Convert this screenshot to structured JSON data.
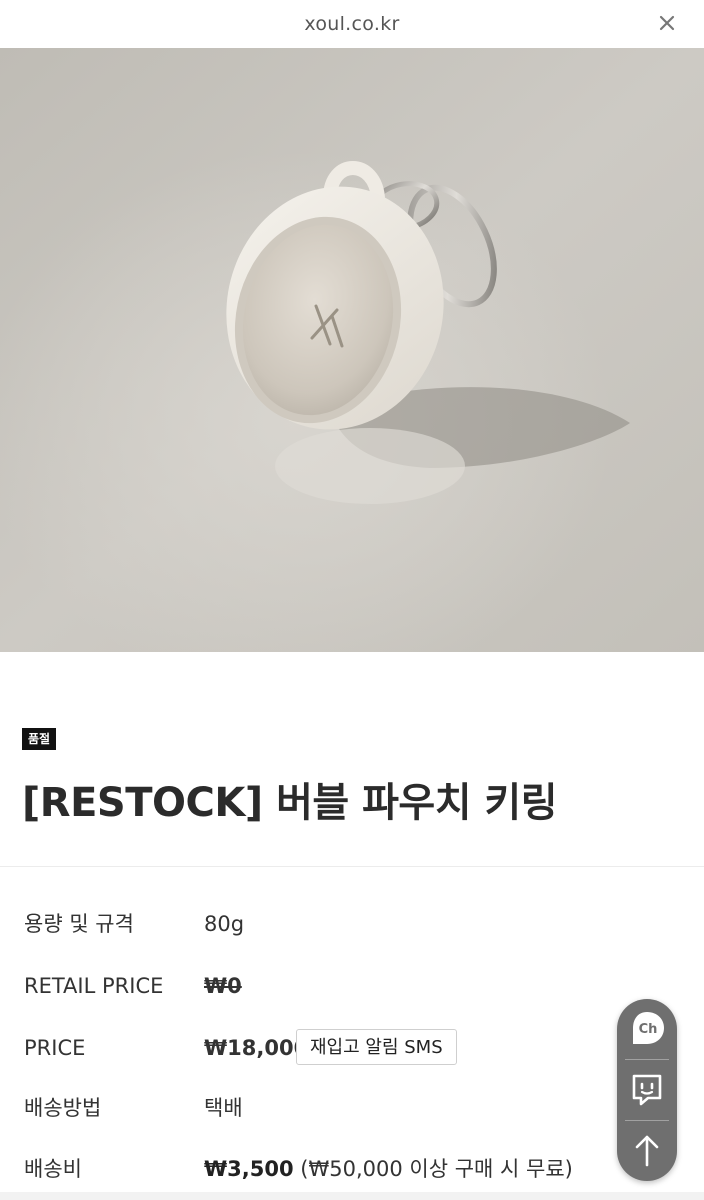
{
  "browser": {
    "url": "xoul.co.kr",
    "close_icon": "close-icon"
  },
  "product": {
    "image_alt": "bubble pouch keyring product photo",
    "status_badge": "품절",
    "title": "[RESTOCK] 버블 파우치 키링"
  },
  "specs": [
    {
      "label": "용량 및 규격",
      "value": "80g"
    },
    {
      "label": "RETAIL PRICE",
      "value": "₩0"
    },
    {
      "label": "PRICE",
      "value": "₩18,000",
      "button": "재입고 알림 SMS"
    },
    {
      "label": "배송방법",
      "value": "택배"
    },
    {
      "label": "배송비",
      "value": "₩3,500",
      "note": "(₩50,000 이상 구매 시 무료)"
    }
  ],
  "floating_menu": {
    "items": [
      "channel-talk-icon",
      "chat-icon",
      "scroll-top-icon"
    ],
    "channel_label": "Ch"
  },
  "colors": {
    "badge_bg": "#111111",
    "floater_bg": "#6f6f6f",
    "photo_bg": "#c9c6c0"
  }
}
